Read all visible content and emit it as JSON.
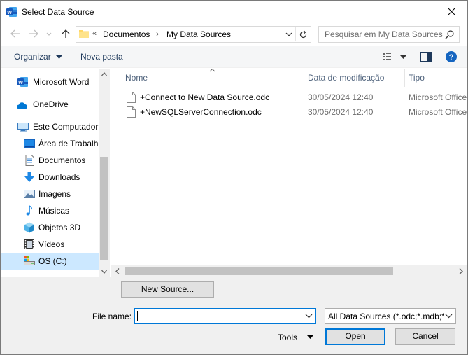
{
  "window": {
    "title": "Select Data Source",
    "app_icon": "word-icon"
  },
  "navbar": {
    "path_overflow": "«",
    "breadcrumb": [
      "Documentos",
      "My Data Sources"
    ],
    "search_placeholder": "Pesquisar em My Data Sources"
  },
  "toolbar": {
    "organize": "Organizar",
    "new_folder": "Nova pasta"
  },
  "sidebar": {
    "items": [
      {
        "label": "Microsoft Word",
        "icon": "word-icon"
      },
      {
        "label": "OneDrive",
        "icon": "cloud-icon"
      },
      {
        "label": "Este Computador",
        "icon": "computer-icon"
      },
      {
        "label": "Área de Trabalho",
        "icon": "desktop-icon"
      },
      {
        "label": "Documentos",
        "icon": "documents-icon"
      },
      {
        "label": "Downloads",
        "icon": "download-icon"
      },
      {
        "label": "Imagens",
        "icon": "pictures-icon"
      },
      {
        "label": "Músicas",
        "icon": "music-icon"
      },
      {
        "label": "Objetos 3D",
        "icon": "cube-icon"
      },
      {
        "label": "Vídeos",
        "icon": "video-icon"
      },
      {
        "label": "OS (C:)",
        "icon": "drive-icon",
        "selected": true
      }
    ]
  },
  "filelist": {
    "columns": [
      "Nome",
      "Data de modificação",
      "Tipo"
    ],
    "files": [
      {
        "name": "+Connect to New Data Source.odc",
        "date": "30/05/2024 12:40",
        "type": "Microsoft Office"
      },
      {
        "name": "+NewSQLServerConnection.odc",
        "date": "30/05/2024 12:40",
        "type": "Microsoft Office"
      }
    ]
  },
  "bottom": {
    "new_source": "New Source...",
    "file_name_label": "File name:",
    "file_name_value": "",
    "filter": "All Data Sources (*.odc;*.mdb;*",
    "tools": "Tools",
    "open": "Open",
    "cancel": "Cancel"
  },
  "colors": {
    "accent": "#0078d7",
    "selected_bg": "#cce8ff",
    "toolbar_bg": "#f5f6f7",
    "footer_bg": "#f0f0f0"
  }
}
